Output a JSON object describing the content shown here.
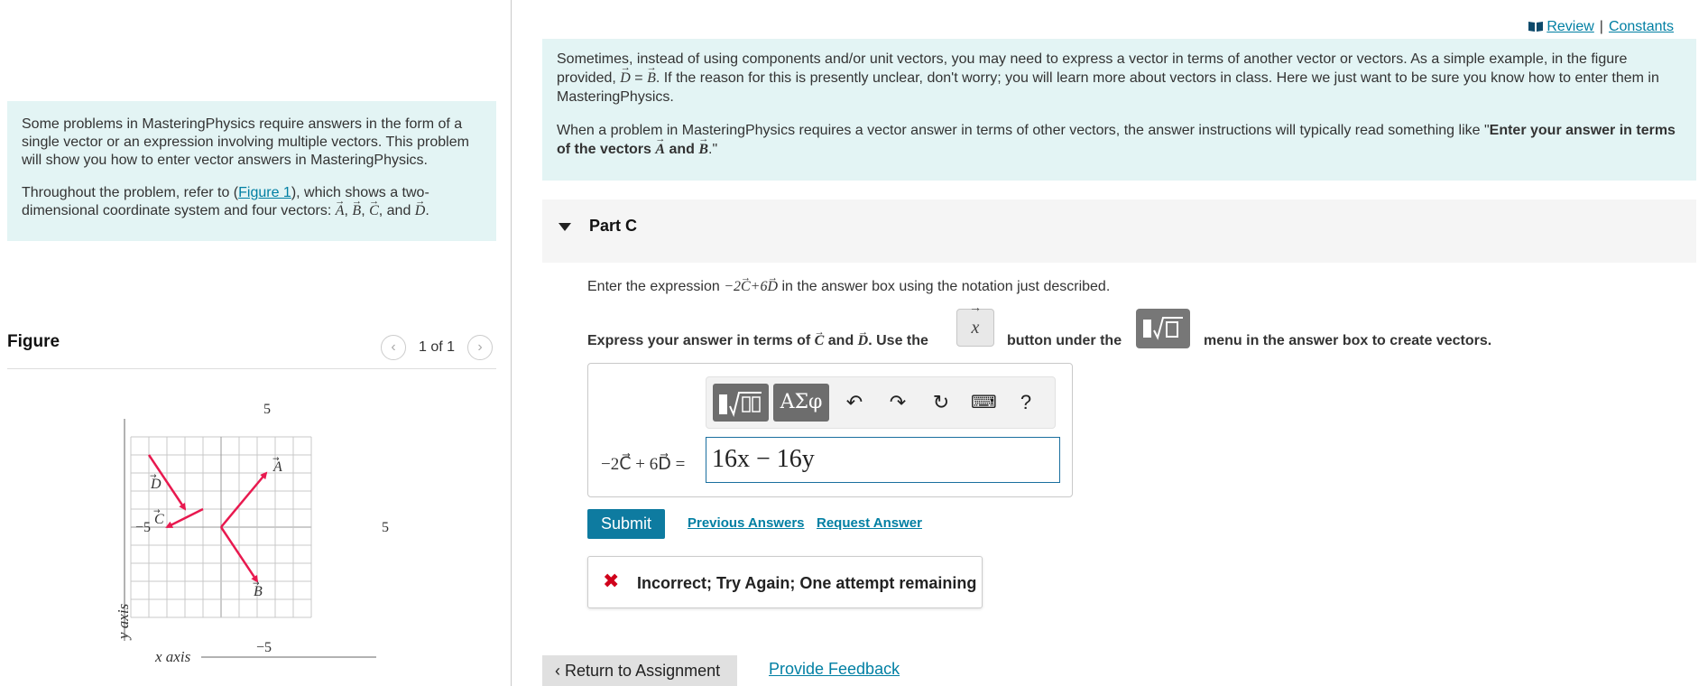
{
  "left": {
    "intro_p1": "Some problems in MasteringPhysics require answers in the form of a single vector or an expression involving multiple vectors. This problem will show you how to enter vector answers in MasteringPhysics.",
    "intro_p2_before": "Throughout the problem, refer to (",
    "figure_link": "Figure 1",
    "intro_p2_after": "), which shows a two-dimensional coordinate system and four vectors: ",
    "figure_title": "Figure",
    "figure_counter": "1 of 1",
    "figure": {
      "top_tick": "5",
      "left_tick": "−5",
      "right_tick": "5",
      "bottom_tick": "−5",
      "x_axis_label": "x axis",
      "y_axis_label": "y axis",
      "vectors": [
        {
          "name": "A",
          "from": [
            0,
            0
          ],
          "to": [
            2.5,
            3
          ]
        },
        {
          "name": "B",
          "from": [
            0,
            0
          ],
          "to": [
            2,
            -3
          ]
        },
        {
          "name": "C",
          "from": [
            -1,
            1
          ],
          "to": [
            -3,
            0
          ]
        },
        {
          "name": "D",
          "from": [
            -4,
            4
          ],
          "to": [
            -2,
            1
          ]
        }
      ],
      "vector_color": "#e8194f"
    }
  },
  "header": {
    "review": "Review",
    "separator": "|",
    "constants": "Constants"
  },
  "info": {
    "p1_a": "Sometimes, instead of using components and/or unit vectors, you may need to express a vector in terms of another vector or vectors. As a simple example, in the figure provided, ",
    "p1_b": ". If the reason for this is presently unclear, don't worry; you will learn more about vectors in class. Here we just want to be sure you know how to enter them in MasteringPhysics.",
    "p2_a": "When a problem in MasteringPhysics requires a vector answer in terms of other vectors, the answer instructions will typically read something like \"",
    "p2_bold": "Enter your answer in terms of the vectors ",
    "p2_and": " and ",
    "p2_end": ".\""
  },
  "part": {
    "title": "Part C"
  },
  "question": {
    "instruction_a": "Enter the expression ",
    "instruction_b": " in the answer box using the notation just described.",
    "express_a": "Express your answer in terms of ",
    "express_and": " and ",
    "express_b": ". Use the",
    "button_under": "button under the",
    "menu_text": "menu in the answer box to create vectors."
  },
  "answer": {
    "equation_label": "−2C⃗ + 6D⃗ =",
    "value": "16x − 16y",
    "toolbar": {
      "symbols": "ΑΣφ",
      "help": "?"
    }
  },
  "actions": {
    "submit": "Submit",
    "previous_answers": "Previous Answers",
    "request_answer": "Request Answer"
  },
  "feedback": {
    "message": "Incorrect; Try Again; One attempt remaining"
  },
  "footer": {
    "return": "Return to Assignment",
    "provide_feedback": "Provide Feedback"
  },
  "colors": {
    "accent": "#0e7ba0",
    "panel_bg": "#e3f4f4",
    "error": "#d0021b"
  }
}
